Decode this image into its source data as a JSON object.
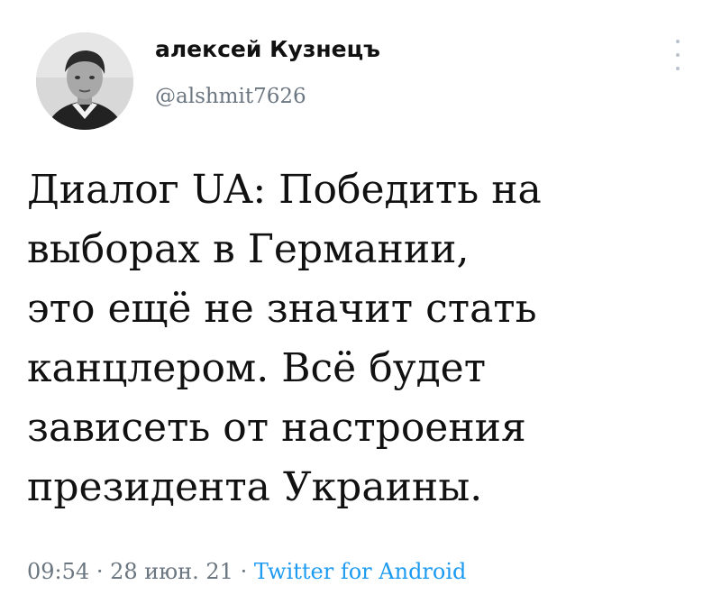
{
  "author": {
    "display_name": "алексей Кузнецъ",
    "handle": "@alshmit7626",
    "avatar": "profile-photo"
  },
  "tweet": {
    "lines": [
      "Диалог UA: Победить на",
      "выборах в Германии,",
      "это ещё не значит стать",
      "канцлером. Всё будет",
      "зависеть от настроения",
      "президента Украины."
    ]
  },
  "meta": {
    "time": "09:54",
    "separator": "·",
    "date": "28 июн. 21",
    "source": "Twitter for Android"
  },
  "icons": {
    "more": "more-vertical-icon"
  },
  "colors": {
    "text": "#0f1419",
    "secondary": "#6b7680",
    "link": "#1d9bf0"
  }
}
